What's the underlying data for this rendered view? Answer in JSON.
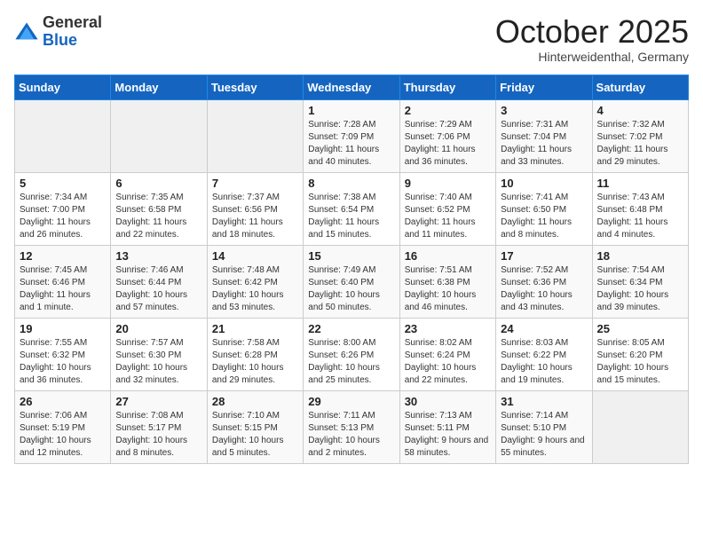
{
  "logo": {
    "general": "General",
    "blue": "Blue"
  },
  "header": {
    "month": "October 2025",
    "location": "Hinterweidenthal, Germany"
  },
  "days": [
    "Sunday",
    "Monday",
    "Tuesday",
    "Wednesday",
    "Thursday",
    "Friday",
    "Saturday"
  ],
  "weeks": [
    [
      {
        "day": "",
        "content": ""
      },
      {
        "day": "",
        "content": ""
      },
      {
        "day": "",
        "content": ""
      },
      {
        "day": "1",
        "content": "Sunrise: 7:28 AM\nSunset: 7:09 PM\nDaylight: 11 hours and 40 minutes."
      },
      {
        "day": "2",
        "content": "Sunrise: 7:29 AM\nSunset: 7:06 PM\nDaylight: 11 hours and 36 minutes."
      },
      {
        "day": "3",
        "content": "Sunrise: 7:31 AM\nSunset: 7:04 PM\nDaylight: 11 hours and 33 minutes."
      },
      {
        "day": "4",
        "content": "Sunrise: 7:32 AM\nSunset: 7:02 PM\nDaylight: 11 hours and 29 minutes."
      }
    ],
    [
      {
        "day": "5",
        "content": "Sunrise: 7:34 AM\nSunset: 7:00 PM\nDaylight: 11 hours and 26 minutes."
      },
      {
        "day": "6",
        "content": "Sunrise: 7:35 AM\nSunset: 6:58 PM\nDaylight: 11 hours and 22 minutes."
      },
      {
        "day": "7",
        "content": "Sunrise: 7:37 AM\nSunset: 6:56 PM\nDaylight: 11 hours and 18 minutes."
      },
      {
        "day": "8",
        "content": "Sunrise: 7:38 AM\nSunset: 6:54 PM\nDaylight: 11 hours and 15 minutes."
      },
      {
        "day": "9",
        "content": "Sunrise: 7:40 AM\nSunset: 6:52 PM\nDaylight: 11 hours and 11 minutes."
      },
      {
        "day": "10",
        "content": "Sunrise: 7:41 AM\nSunset: 6:50 PM\nDaylight: 11 hours and 8 minutes."
      },
      {
        "day": "11",
        "content": "Sunrise: 7:43 AM\nSunset: 6:48 PM\nDaylight: 11 hours and 4 minutes."
      }
    ],
    [
      {
        "day": "12",
        "content": "Sunrise: 7:45 AM\nSunset: 6:46 PM\nDaylight: 11 hours and 1 minute."
      },
      {
        "day": "13",
        "content": "Sunrise: 7:46 AM\nSunset: 6:44 PM\nDaylight: 10 hours and 57 minutes."
      },
      {
        "day": "14",
        "content": "Sunrise: 7:48 AM\nSunset: 6:42 PM\nDaylight: 10 hours and 53 minutes."
      },
      {
        "day": "15",
        "content": "Sunrise: 7:49 AM\nSunset: 6:40 PM\nDaylight: 10 hours and 50 minutes."
      },
      {
        "day": "16",
        "content": "Sunrise: 7:51 AM\nSunset: 6:38 PM\nDaylight: 10 hours and 46 minutes."
      },
      {
        "day": "17",
        "content": "Sunrise: 7:52 AM\nSunset: 6:36 PM\nDaylight: 10 hours and 43 minutes."
      },
      {
        "day": "18",
        "content": "Sunrise: 7:54 AM\nSunset: 6:34 PM\nDaylight: 10 hours and 39 minutes."
      }
    ],
    [
      {
        "day": "19",
        "content": "Sunrise: 7:55 AM\nSunset: 6:32 PM\nDaylight: 10 hours and 36 minutes."
      },
      {
        "day": "20",
        "content": "Sunrise: 7:57 AM\nSunset: 6:30 PM\nDaylight: 10 hours and 32 minutes."
      },
      {
        "day": "21",
        "content": "Sunrise: 7:58 AM\nSunset: 6:28 PM\nDaylight: 10 hours and 29 minutes."
      },
      {
        "day": "22",
        "content": "Sunrise: 8:00 AM\nSunset: 6:26 PM\nDaylight: 10 hours and 25 minutes."
      },
      {
        "day": "23",
        "content": "Sunrise: 8:02 AM\nSunset: 6:24 PM\nDaylight: 10 hours and 22 minutes."
      },
      {
        "day": "24",
        "content": "Sunrise: 8:03 AM\nSunset: 6:22 PM\nDaylight: 10 hours and 19 minutes."
      },
      {
        "day": "25",
        "content": "Sunrise: 8:05 AM\nSunset: 6:20 PM\nDaylight: 10 hours and 15 minutes."
      }
    ],
    [
      {
        "day": "26",
        "content": "Sunrise: 7:06 AM\nSunset: 5:19 PM\nDaylight: 10 hours and 12 minutes."
      },
      {
        "day": "27",
        "content": "Sunrise: 7:08 AM\nSunset: 5:17 PM\nDaylight: 10 hours and 8 minutes."
      },
      {
        "day": "28",
        "content": "Sunrise: 7:10 AM\nSunset: 5:15 PM\nDaylight: 10 hours and 5 minutes."
      },
      {
        "day": "29",
        "content": "Sunrise: 7:11 AM\nSunset: 5:13 PM\nDaylight: 10 hours and 2 minutes."
      },
      {
        "day": "30",
        "content": "Sunrise: 7:13 AM\nSunset: 5:11 PM\nDaylight: 9 hours and 58 minutes."
      },
      {
        "day": "31",
        "content": "Sunrise: 7:14 AM\nSunset: 5:10 PM\nDaylight: 9 hours and 55 minutes."
      },
      {
        "day": "",
        "content": ""
      }
    ]
  ]
}
